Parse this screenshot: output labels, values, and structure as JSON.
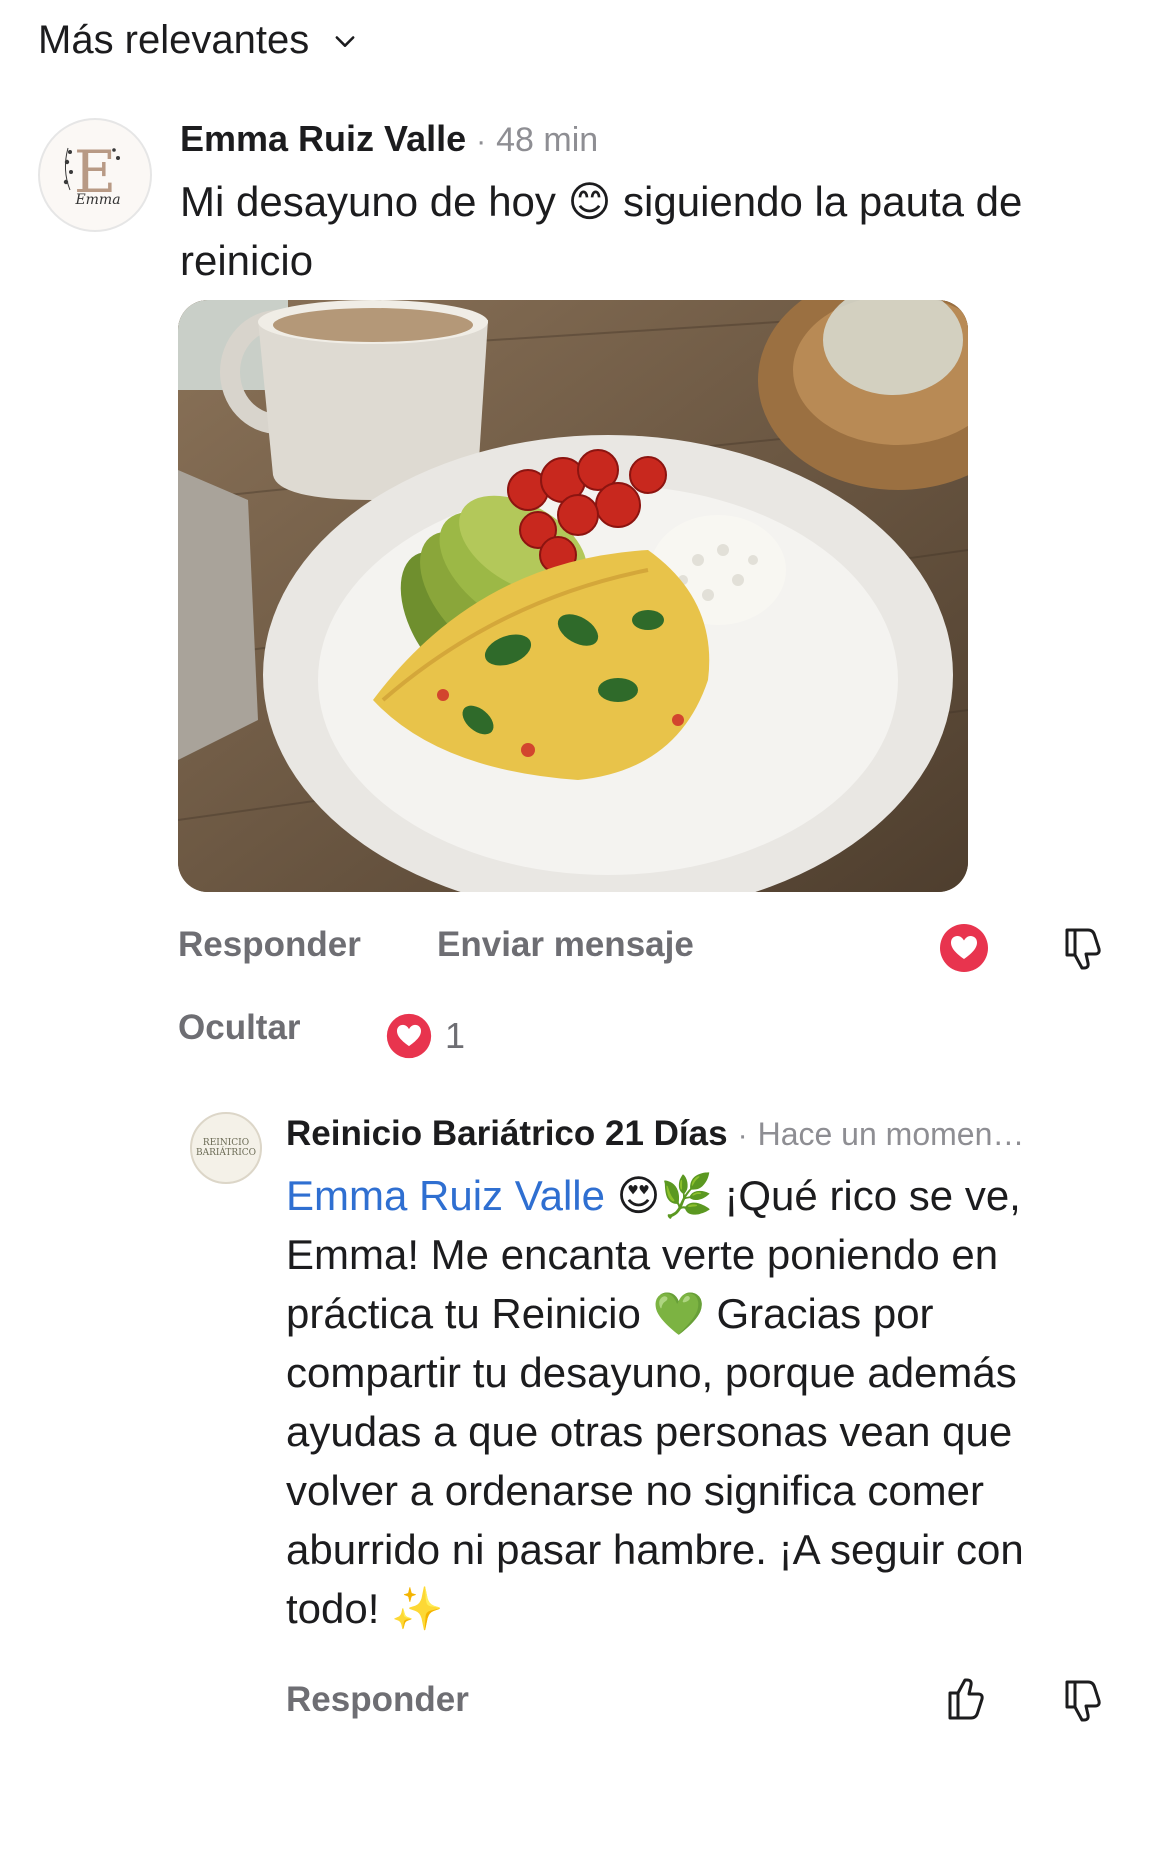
{
  "sort": {
    "label": "Más relevantes"
  },
  "comment1": {
    "author": "Emma Ruiz Valle",
    "time": "48 min",
    "text_part1": "Mi desayuno de hoy ",
    "emoji1": "😊",
    "text_part2": " siguiendo la pauta de reinicio",
    "reply_label": "Responder",
    "message_label": "Enviar mensaje",
    "hide_label": "Ocultar",
    "reaction_count": "1"
  },
  "reply1": {
    "author": "Reinicio Bariátrico 21 Días",
    "time": "Hace un momen…",
    "mention": "Emma Ruiz Valle",
    "emojis1": " 😍🌿 ",
    "text_a": "¡Qué rico se ve, Emma! Me encanta verte poniendo en práctica tu Reinicio ",
    "emoji2": "💚",
    "text_b": " Gracias por compartir tu desayuno, porque además ayudas a que otras personas vean que volver a ordenarse no significa comer aburrido ni pasar hambre. ¡A seguir con todo! ",
    "emoji3": "✨",
    "reply_label": "Responder"
  },
  "avatars": {
    "emma_initial": "E",
    "emma_script": "Emma",
    "brand_line1": "REINICIO",
    "brand_line2": "BARIÁTRICO"
  },
  "colors": {
    "mention": "#2f6fd1",
    "heart": "#e8344e",
    "muted": "#6e6e73"
  }
}
